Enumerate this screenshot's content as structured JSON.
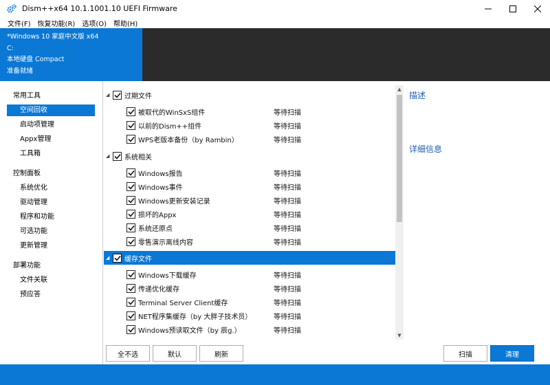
{
  "window": {
    "title": "Dism++x64 10.1.1001.10 UEFI Firmware",
    "accent": "#0a78d4"
  },
  "menu": [
    "文件(F)",
    "恢复功能(R)",
    "选项(O)",
    "帮助(H)"
  ],
  "session": {
    "line1": "*Windows 10 家庭中文版 x64",
    "line2": "C:",
    "line3": "本地硬盘 Compact",
    "line4": "准备就绪"
  },
  "sidebar": {
    "groups": [
      "常用工具",
      "控制面板",
      "部署功能"
    ],
    "items": [
      "空间回收",
      "启动项管理",
      "Appx管理",
      "工具箱",
      "系统优化",
      "驱动管理",
      "程序和功能",
      "可选功能",
      "更新管理",
      "文件关联",
      "预应答"
    ]
  },
  "list": {
    "status_pending": "等待扫描",
    "groups": [
      "过期文件",
      "系统相关",
      "缓存文件"
    ],
    "items": [
      "被取代的WinSxS组件",
      "以前的Dism++组件",
      "WPS老版本备份（by Rambin）",
      "Windows报告",
      "Windows事件",
      "Windows更新安装记录",
      "损坏的Appx",
      "系统还原点",
      "零售演示离线内容",
      "Windows下载缓存",
      "传递优化缓存",
      "Terminal Server Client缓存",
      "NET程序集缓存（by 大胖子技术员）",
      "Windows预读取文件（by 辰g.）"
    ]
  },
  "right_pane": {
    "description_title": "描述",
    "details_title": "详细信息"
  },
  "buttons": {
    "deselect_all": "全不选",
    "default": "默认",
    "refresh": "刷新",
    "scan": "扫描",
    "clean": "清理"
  }
}
